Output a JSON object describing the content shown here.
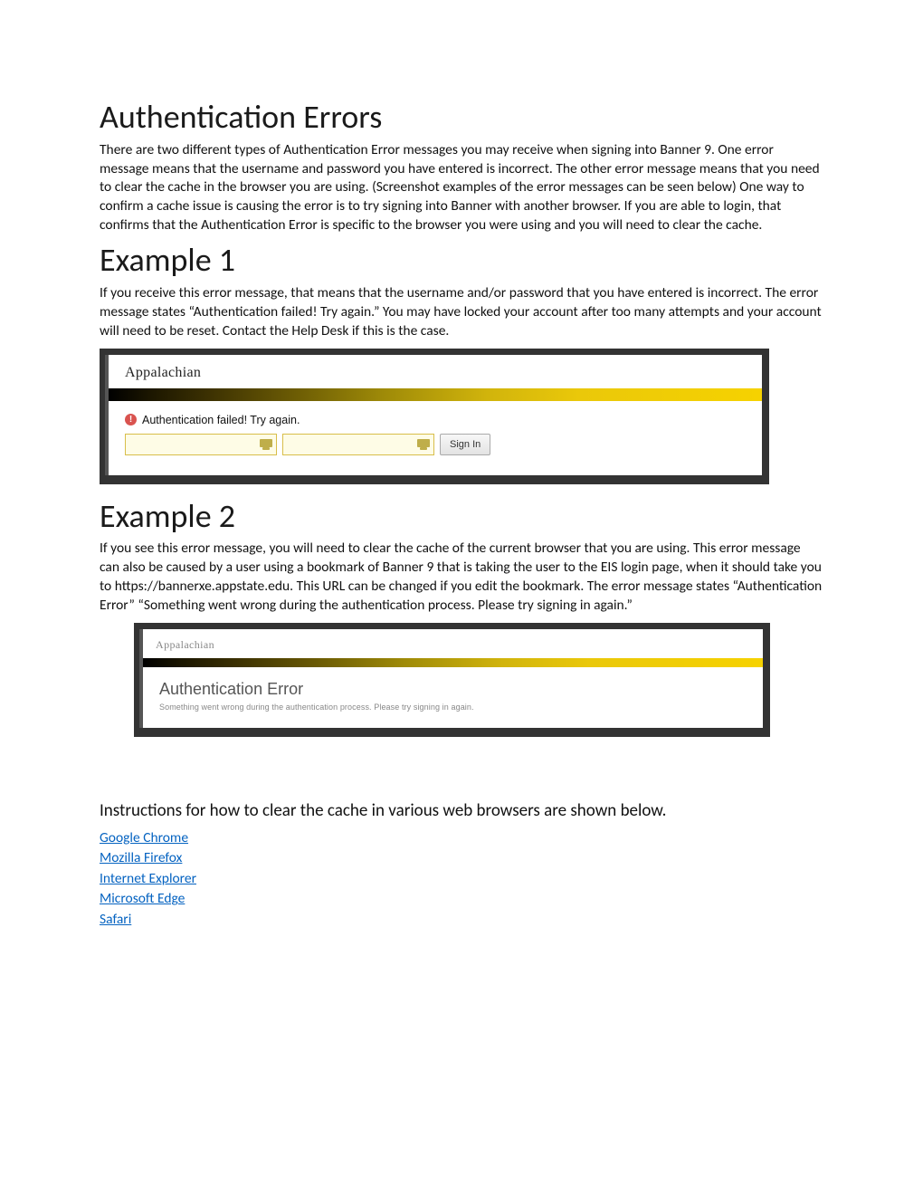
{
  "title": "Authentication Errors",
  "intro": "There are two different types of Authentication Error messages you may receive when signing into Banner 9. One error message means that the username and password you have entered is incorrect. The other error message means that you need to clear the cache in the browser you are using. (Screenshot examples of the error messages can be seen below) One way to confirm a cache issue is causing the error is to try signing into Banner with another browser. If you are able to login, that confirms that the Authentication Error is specific to the browser you were using and you will need to clear the cache.",
  "example1": {
    "heading": "Example 1",
    "text": "If you receive this error message, that means that the username and/or password that you have entered is incorrect. The error message states “Authentication failed! Try again.” You may have locked your account after too many attempts and your account will need to be reset. Contact the Help Desk if this is the case.",
    "screenshot": {
      "logo": "Appalachian",
      "error_msg": "Authentication failed! Try again.",
      "signin_label": "Sign In"
    }
  },
  "example2": {
    "heading": "Example 2",
    "text": "If you see this error message, you will need to clear the cache of the current browser that you are using. This error message can also be caused by a user using a bookmark of Banner 9 that is taking the user to the EIS login page, when it should take you to https://bannerxe.appstate.edu. This URL can be changed if you edit the bookmark. The error message states “Authentication Error” “Something went wrong during the authentication process. Please try signing in again.”",
    "screenshot": {
      "logo": "Appalachian",
      "title": "Authentication Error",
      "subtitle": "Something went wrong during the authentication process. Please try signing in again."
    }
  },
  "instructions_heading": "Instructions for how to clear the cache in various web browsers are shown below.",
  "links": [
    "Google Chrome",
    "Mozilla Firefox",
    "Internet Explorer",
    "Microsoft Edge",
    "Safari"
  ]
}
